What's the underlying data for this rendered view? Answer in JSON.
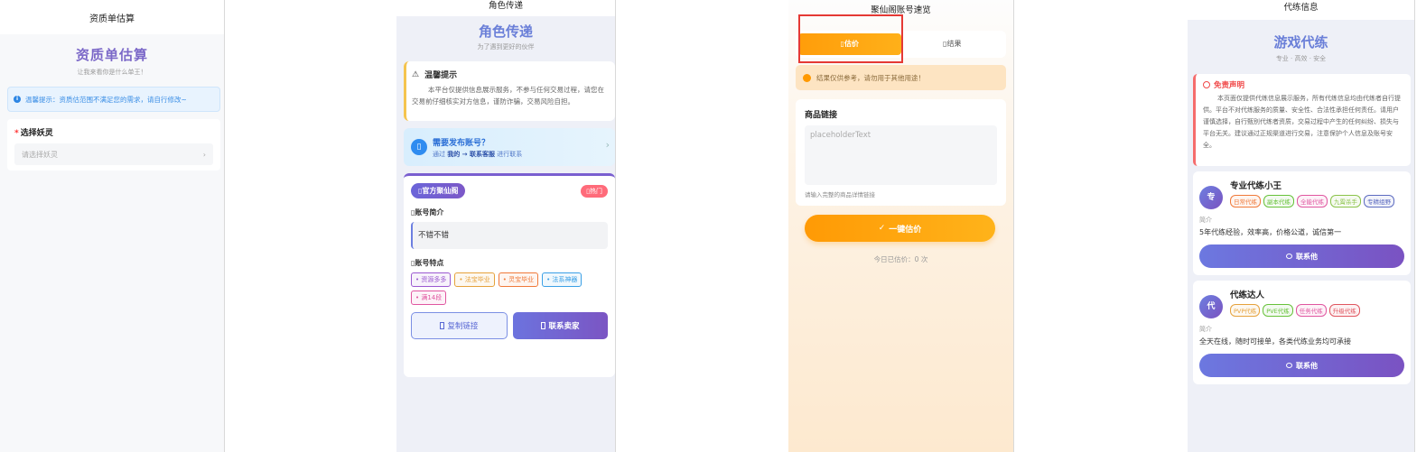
{
  "screen1": {
    "nav_title": "资质单估算",
    "hero_title": "资质单估算",
    "hero_subtitle": "让我来看你是什么单王！",
    "notice_icon": "i",
    "notice": "温馨提示：资质估范围不满足您的需求，请自行修改~",
    "required_mark": "*",
    "field_label": "选择妖灵",
    "select_placeholder": "请选择妖灵",
    "chevron": "›"
  },
  "screen2": {
    "nav_title": "角色传递",
    "hero_title": "角色传递",
    "hero_subtitle": "为了遇到更好的伙伴",
    "warning_icon": "⚠",
    "warning_title": "温馨提示",
    "warning_text": "本平台仅提供信息展示服务，不参与任何交易过程，请您在交易前仔细核实对方信息，谨防诈骗，交易风险自担。",
    "publish_icon": "▯",
    "publish_title": "需要发布账号？",
    "publish_prefix": "通过",
    "publish_path": "我的 → 联系客服",
    "publish_suffix": "进行联系",
    "chevron": "›",
    "official_badge": "▯官方聚仙阁",
    "hot_badge": "▯热门",
    "intro_label": "▯账号简介",
    "intro_value": "不错不错",
    "features_label": "▯账号特点",
    "tags": [
      {
        "label": "• 资源多多",
        "color": "#9b59d0"
      },
      {
        "label": "• 法宝毕业",
        "color": "#e6a23c"
      },
      {
        "label": "• 灵宝毕业",
        "color": "#f07a3a"
      },
      {
        "label": "• 法系神器",
        "color": "#3ba0e6"
      },
      {
        "label": "• 满14段",
        "color": "#e056a0"
      }
    ],
    "copy_button": "复制链接",
    "contact_button": "联系卖家"
  },
  "screen3": {
    "nav_title": "聚仙阁账号速览",
    "tab_active": "▯估价",
    "tab_inactive": "▯结果",
    "tip": "结果仅供参考，请勿用于其他用途！",
    "card_title": "商品链接",
    "textarea_placeholder": "placeholderText",
    "hint": "请输入完整的商品详情链接",
    "cta_icon": "✓",
    "cta": "一键估价",
    "count": "今日已估价：0 次"
  },
  "screen4": {
    "nav_title": "代练信息",
    "hero_title": "游戏代练",
    "hero_subtitle": "专业 · 高效 · 安全",
    "disclaimer_title": "免责声明",
    "disclaimer_text": "本页面仅提供代练信息展示服务，所有代练信息均由代练者自行提供。平台不对代练服务的质量、安全性、合法性承担任何责任。请用户谨慎选择，自行甄别代练者资质，交易过程中产生的任何纠纷、损失与平台无关。建议通过正规渠道进行交易，注意保护个人信息及账号安全。",
    "providers": [
      {
        "avatar": "专",
        "name": "专业代练小王",
        "tags": [
          {
            "label": "日常代练",
            "color": "#f07a3a"
          },
          {
            "label": "副本代练",
            "color": "#67c23a"
          },
          {
            "label": "全能代练",
            "color": "#e056a0"
          },
          {
            "label": "九霄杀手",
            "color": "#8bc34a"
          },
          {
            "label": "专精组野",
            "color": "#5c6bc0"
          }
        ],
        "label": "简介",
        "desc": "5年代练经验，效率高，价格公道，诚信第一",
        "button": "联系他"
      },
      {
        "avatar": "代",
        "name": "代练达人",
        "tags": [
          {
            "label": "PVP代练",
            "color": "#e6a23c"
          },
          {
            "label": "PVE代练",
            "color": "#67c23a"
          },
          {
            "label": "任务代练",
            "color": "#e056a0"
          },
          {
            "label": "升级代练",
            "color": "#e05660"
          }
        ],
        "label": "简介",
        "desc": "全天在线，随时可接单，各类代练业务均可承接",
        "button": "联系他"
      }
    ]
  }
}
